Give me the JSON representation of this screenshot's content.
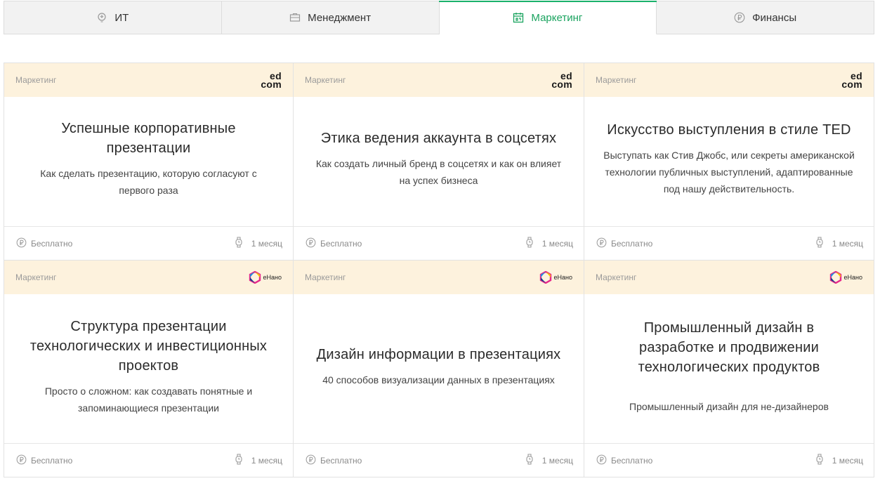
{
  "tabs": [
    {
      "label": "ИТ",
      "icon": "lightbulb-icon",
      "active": false
    },
    {
      "label": "Менеджмент",
      "icon": "briefcase-icon",
      "active": false
    },
    {
      "label": "Маркетинг",
      "icon": "calendar-icon",
      "active": true
    },
    {
      "label": "Финансы",
      "icon": "ruble-icon",
      "active": false
    }
  ],
  "colors": {
    "accent": "#1ab26b",
    "card_header": "#fdf2dd"
  },
  "cards": [
    {
      "category": "Маркетинг",
      "provider": "ed com",
      "provider_line1": "ed",
      "provider_line2": "com",
      "title": "Успешные корпоративные презентации",
      "description": "Как сделать презентацию, которую согласуют с первого раза",
      "price": "Бесплатно",
      "duration": "1 месяц"
    },
    {
      "category": "Маркетинг",
      "provider": "ed com",
      "provider_line1": "ed",
      "provider_line2": "com",
      "title": "Этика ведения аккаунта в соцсетях",
      "description": "Как создать личный бренд в соцсетях и как он влияет на успех бизнеса",
      "price": "Бесплатно",
      "duration": "1 месяц"
    },
    {
      "category": "Маркетинг",
      "provider": "ed com",
      "provider_line1": "ed",
      "provider_line2": "com",
      "title": "Искусство выступления в стиле TED",
      "description": "Выступать как Стив Джобс, или секреты американской технологии публичных выступлений, адаптированные под нашу действительность.",
      "price": "Бесплатно",
      "duration": "1 месяц"
    },
    {
      "category": "Маркетинг",
      "provider": "eНано",
      "title": "Структура презентации технологических и инвестиционных проектов",
      "description": "Просто о сложном: как создавать понятные и запоминающиеся презентации",
      "price": "Бесплатно",
      "duration": "1 месяц"
    },
    {
      "category": "Маркетинг",
      "provider": "eНано",
      "title": "Дизайн информации в презентациях",
      "description": "40 способов визуализации данных в презентациях",
      "price": "Бесплатно",
      "duration": "1 месяц"
    },
    {
      "category": "Маркетинг",
      "provider": "eНано",
      "title": "Промышленный дизайн в разработке и продвижении технологических продуктов",
      "description": "Промышленный дизайн для не-дизайнеров",
      "price": "Бесплатно",
      "duration": "1 месяц"
    }
  ]
}
